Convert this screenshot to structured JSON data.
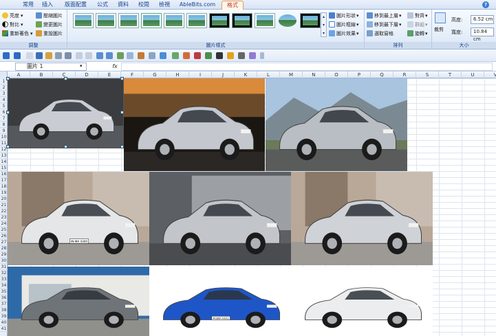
{
  "ribbon_tabs": [
    "常用",
    "插入",
    "版面配置",
    "公式",
    "資料",
    "校閱",
    "檢視",
    "AbleBits.com",
    "格式"
  ],
  "active_tab": "格式",
  "adjust_group": {
    "label": "調整",
    "buttons": [
      "亮度",
      "對比",
      "重新著色",
      "壓縮圖片",
      "變更圖片",
      "重設圖片"
    ]
  },
  "picture_styles_group": {
    "label": "圖片樣式",
    "buttons": [
      "圖片形狀",
      "圖片框線",
      "圖片效果"
    ]
  },
  "arrange_group": {
    "label": "排列",
    "buttons": [
      "移到最上層",
      "移到最下層",
      "選取窗格",
      "對齊",
      "群組",
      "旋轉"
    ]
  },
  "size_group": {
    "label": "大小",
    "crop_label": "裁剪",
    "height_label": "高度:",
    "height_value": "6.52 cm",
    "width_label": "寬度:",
    "width_value": "10.84 cm"
  },
  "name_box": "圖片 1",
  "fx_label": "fx",
  "columns": [
    "A",
    "B",
    "C",
    "D",
    "E",
    "F",
    "G",
    "H",
    "I",
    "J",
    "K",
    "L",
    "M",
    "N",
    "O",
    "P",
    "Q",
    "R",
    "S",
    "T",
    "U",
    "V"
  ],
  "rows": [
    "1",
    "2",
    "3",
    "4",
    "5",
    "6",
    "7",
    "8",
    "9",
    "10",
    "11",
    "12",
    "13",
    "14",
    "15",
    "16",
    "17",
    "18",
    "19",
    "20",
    "21",
    "22",
    "23",
    "24",
    "25",
    "26",
    "27",
    "28",
    "29",
    "30",
    "31",
    "32",
    "33",
    "34",
    "35",
    "36",
    "37",
    "38",
    "39",
    "40",
    "41"
  ],
  "photos": [
    {
      "name": "silver-sports-coupe",
      "body": "#c9cdd3",
      "bg": "studio",
      "plate": ""
    },
    {
      "name": "silver-hatchback",
      "body": "#c4c8ce",
      "bg": "sunset",
      "plate": ""
    },
    {
      "name": "silver-pickup-truck",
      "body": "#b9bec4",
      "bg": "mountain",
      "plate": ""
    },
    {
      "name": "white-wagon",
      "body": "#e4e6e8",
      "bg": "building",
      "plate": "IN-MA 4300"
    },
    {
      "name": "silver-minivan",
      "body": "#c2c6cb",
      "bg": "garage",
      "plate": ""
    },
    {
      "name": "silver-coupe",
      "body": "#cfd2d6",
      "bg": "building",
      "plate": ""
    },
    {
      "name": "grey-sedan",
      "body": "#6f7478",
      "bg": "house",
      "plate": ""
    },
    {
      "name": "blue-convertible",
      "body": "#1e56c8",
      "bg": "white",
      "plate": "M·BW 4301"
    },
    {
      "name": "white-suv",
      "body": "#ecedee",
      "bg": "white",
      "plate": ""
    }
  ]
}
